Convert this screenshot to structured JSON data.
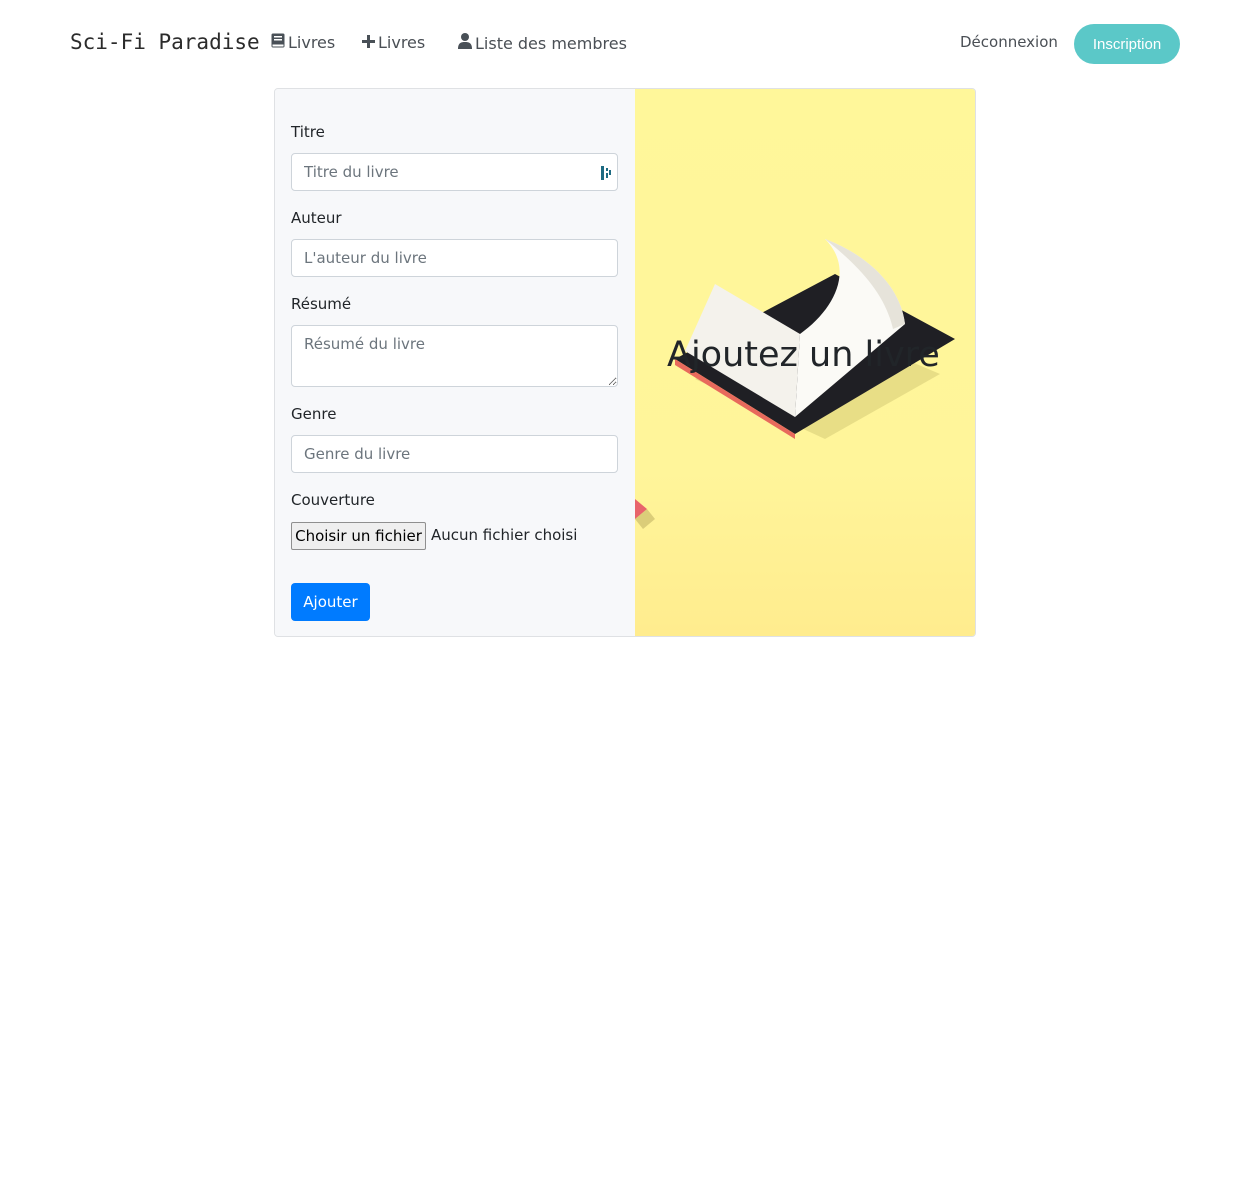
{
  "navbar": {
    "brand": "Sci-Fi Paradise",
    "links": [
      {
        "label": "Livres",
        "icon": "book-icon"
      },
      {
        "label": "Livres",
        "icon": "plus-icon"
      },
      {
        "label": "Liste des membres",
        "icon": "user-icon"
      }
    ],
    "logout": "Déconnexion",
    "signup": "Inscription"
  },
  "form": {
    "title_label": "Titre",
    "title_placeholder": "Titre du livre",
    "author_label": "Auteur",
    "author_placeholder": "L'auteur du livre",
    "summary_label": "Résumé",
    "summary_placeholder": "Résumé du livre",
    "genre_label": "Genre",
    "genre_placeholder": "Genre du livre",
    "cover_label": "Couverture",
    "file_button": "Choisir un fichier",
    "file_status": "Aucun fichier choisi",
    "submit": "Ajouter"
  },
  "hero": {
    "title": "Ajoutez un livre"
  },
  "colors": {
    "accent": "#5bc8c8",
    "primary": "#007bff",
    "hero_bg": "#fff79a"
  }
}
